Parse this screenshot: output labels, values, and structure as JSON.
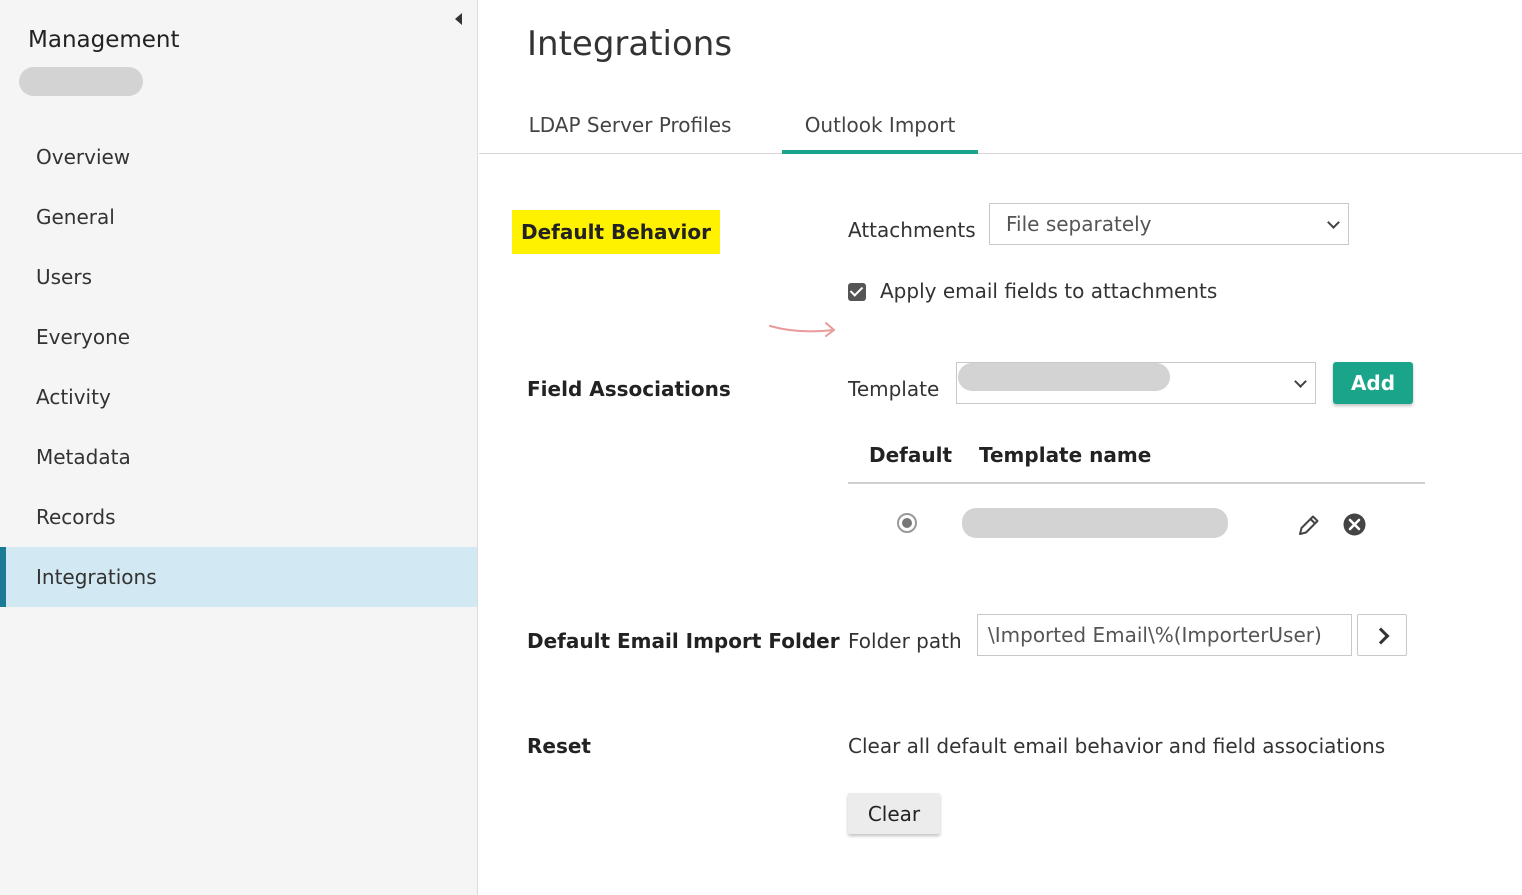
{
  "sidebar": {
    "title": "Management",
    "items": [
      {
        "label": "Overview"
      },
      {
        "label": "General"
      },
      {
        "label": "Users"
      },
      {
        "label": "Everyone"
      },
      {
        "label": "Activity"
      },
      {
        "label": "Metadata"
      },
      {
        "label": "Records"
      },
      {
        "label": "Integrations",
        "active": true
      }
    ]
  },
  "page": {
    "title": "Integrations"
  },
  "tabs": [
    {
      "label": "LDAP Server Profiles"
    },
    {
      "label": "Outlook Import",
      "active": true
    }
  ],
  "default_behavior": {
    "section_label": "Default Behavior",
    "attachments_label": "Attachments",
    "attachments_value": "File separately",
    "apply_email_fields_label": "Apply email fields to attachments",
    "apply_email_fields_checked": true
  },
  "field_associations": {
    "section_label": "Field Associations",
    "template_label": "Template",
    "add_label": "Add",
    "table": {
      "headers": [
        "Default",
        "Template name"
      ]
    }
  },
  "import_folder": {
    "section_label": "Default Email Import Folder",
    "folder_path_label": "Folder path",
    "folder_path_value": "\\Imported Email\\%(ImporterUser)"
  },
  "reset": {
    "section_label": "Reset",
    "description": "Clear all default email behavior and field associations",
    "clear_label": "Clear"
  },
  "colors": {
    "accent": "#1aa58a",
    "highlight": "#fff200",
    "active_nav_bg": "#d2e8f2",
    "active_nav_border": "#1c7a94"
  }
}
